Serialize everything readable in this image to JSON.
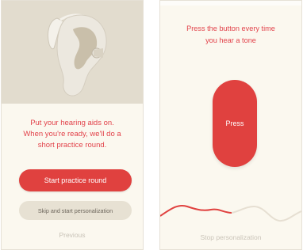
{
  "colors": {
    "accent": "#e0413f",
    "background": "#fbf8ef",
    "hero": "#e2dcce"
  },
  "left_screen": {
    "instruction_lines": [
      "Put your hearing aids on.",
      "When you're ready, we'll do a",
      "short practice round."
    ],
    "primary_button": "Start practice round",
    "secondary_button": "Skip and start personalization",
    "previous_link": "Previous",
    "illustration_icon": "ear-with-hearing-aid-icon"
  },
  "right_screen": {
    "prompt_lines": [
      "Press the button every time",
      "you hear a tone"
    ],
    "press_button": "Press",
    "stop_link": "Stop personalization",
    "progress_icon": "sound-wave-icon"
  }
}
